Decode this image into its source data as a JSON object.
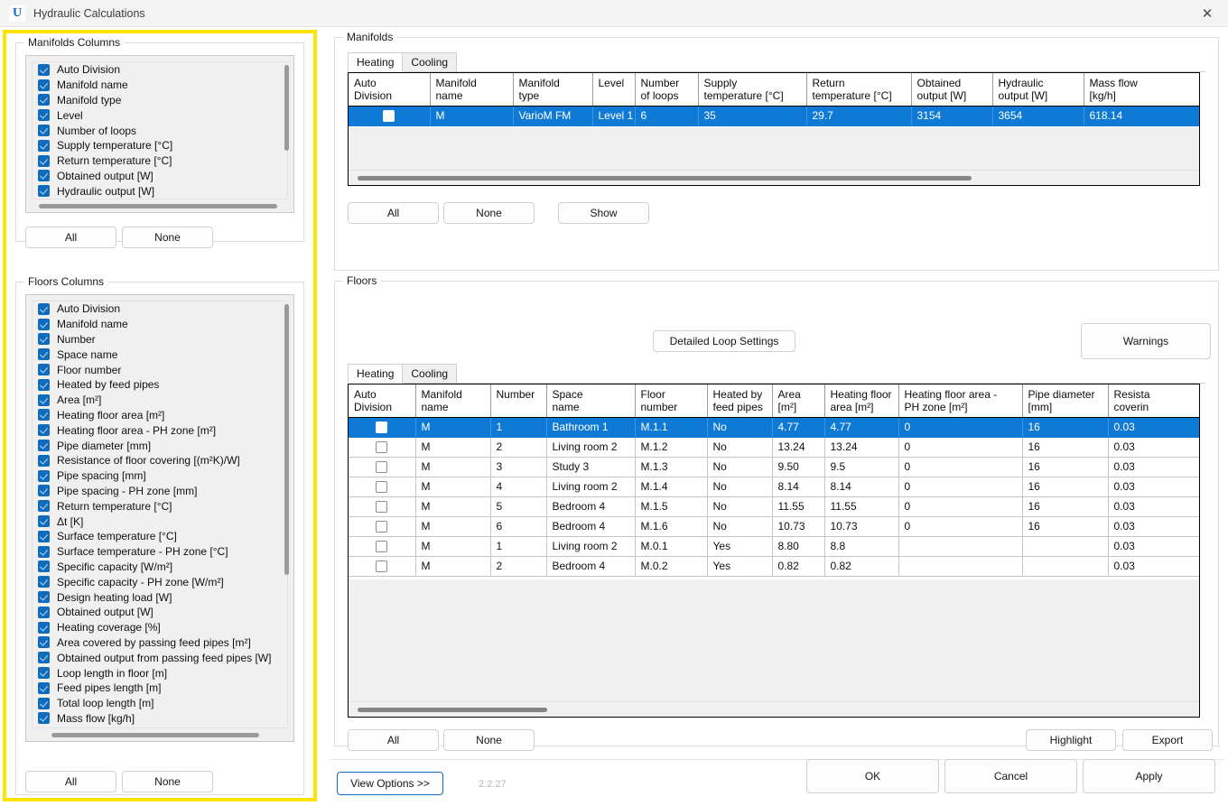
{
  "window": {
    "title": "Hydraulic Calculations",
    "logo_text": "U",
    "close_icon": "close-icon",
    "close_glyph": "✕",
    "highlight_color": "#ffe400",
    "accent_color": "#0f6cbd",
    "selection_color": "#0f7ad6"
  },
  "manifolds_columns": {
    "group_title": "Manifolds Columns",
    "items": [
      "Auto Division",
      "Manifold name",
      "Manifold type",
      "Level",
      "Number of loops",
      "Supply temperature [°C]",
      "Return temperature [°C]",
      "Obtained output [W]",
      "Hydraulic output [W]",
      "Mass flow [kg/h]"
    ],
    "all_label": "All",
    "none_label": "None"
  },
  "floors_columns": {
    "group_title": "Floors Columns",
    "items": [
      "Auto Division",
      "Manifold name",
      "Number",
      "Space name",
      "Floor number",
      "Heated by feed pipes",
      "Area [m²]",
      "Heating floor area [m²]",
      "Heating floor area - PH zone [m²]",
      "Pipe diameter [mm]",
      "Resistance of floor covering [(m²K)/W]",
      "Pipe spacing [mm]",
      "Pipe spacing - PH zone [mm]",
      "Return temperature [°C]",
      "Δt [K]",
      "Surface temperature [°C]",
      "Surface temperature - PH zone [°C]",
      "Specific capacity [W/m²]",
      "Specific capacity - PH zone [W/m²]",
      "Design heating load [W]",
      "Obtained output [W]",
      "Heating coverage [%]",
      "Area covered by passing feed pipes [m²]",
      "Obtained output from passing feed pipes [W]",
      "Loop length in floor  [m]",
      "Feed pipes length  [m]",
      "Total loop length [m]",
      "Mass flow [kg/h]"
    ],
    "all_label": "All",
    "none_label": "None"
  },
  "manifolds_section": {
    "group_title": "Manifolds",
    "tabs": [
      {
        "label": "Heating",
        "active": true
      },
      {
        "label": "Cooling",
        "active": false
      }
    ],
    "headers": [
      "Auto\nDivision",
      "Manifold\nname",
      "Manifold\ntype",
      "Level",
      "Number\nof loops",
      "Supply\ntemperature [°C]",
      "Return\ntemperature [°C]",
      "Obtained\noutput [W]",
      "Hydraulic\noutput [W]",
      "Mass flow\n[kg/h]"
    ],
    "rows": [
      {
        "selected": true,
        "checked": false,
        "cells": [
          "M",
          "VarioM FM",
          "Level 1",
          "6",
          "35",
          "29.7",
          "3154",
          "3654",
          "618.14"
        ]
      }
    ],
    "buttons": {
      "all_label": "All",
      "none_label": "None",
      "show_label": "Show"
    }
  },
  "floors_section": {
    "group_title": "Floors",
    "detailed_loop_settings_label": "Detailed Loop Settings",
    "warnings_label": "Warnings",
    "tabs": [
      {
        "label": "Heating",
        "active": true
      },
      {
        "label": "Cooling",
        "active": false
      }
    ],
    "headers": [
      "Auto\nDivision",
      "Manifold\nname",
      "Number",
      "Space\nname",
      "Floor\nnumber",
      "Heated by\nfeed pipes",
      "Area\n[m²]",
      "Heating floor\narea [m²]",
      "Heating floor area -\nPH zone [m²]",
      "Pipe diameter\n[mm]",
      "Resista\ncoverin"
    ],
    "rows": [
      {
        "selected": true,
        "checked": false,
        "cells": [
          "M",
          "1",
          "Bathroom 1",
          "M.1.1",
          "No",
          "4.77",
          "4.77",
          "0",
          "16",
          "0.03"
        ]
      },
      {
        "selected": false,
        "checked": false,
        "cells": [
          "M",
          "2",
          "Living room 2",
          "M.1.2",
          "No",
          "13.24",
          "13.24",
          "0",
          "16",
          "0.03"
        ]
      },
      {
        "selected": false,
        "checked": false,
        "cells": [
          "M",
          "3",
          "Study 3",
          "M.1.3",
          "No",
          "9.50",
          "9.5",
          "0",
          "16",
          "0.03"
        ]
      },
      {
        "selected": false,
        "checked": false,
        "cells": [
          "M",
          "4",
          "Living room 2",
          "M.1.4",
          "No",
          "8.14",
          "8.14",
          "0",
          "16",
          "0.03"
        ]
      },
      {
        "selected": false,
        "checked": false,
        "cells": [
          "M",
          "5",
          "Bedroom 4",
          "M.1.5",
          "No",
          "11.55",
          "11.55",
          "0",
          "16",
          "0.03"
        ]
      },
      {
        "selected": false,
        "checked": false,
        "cells": [
          "M",
          "6",
          "Bedroom 4",
          "M.1.6",
          "No",
          "10.73",
          "10.73",
          "0",
          "16",
          "0.03"
        ]
      },
      {
        "selected": false,
        "checked": false,
        "cells": [
          "M",
          "1",
          "Living room 2",
          "M.0.1",
          "Yes",
          "8.80",
          "8.8",
          "",
          "",
          "0.03"
        ]
      },
      {
        "selected": false,
        "checked": false,
        "cells": [
          "M",
          "2",
          "Bedroom 4",
          "M.0.2",
          "Yes",
          "0.82",
          "0.82",
          "",
          "",
          "0.03"
        ]
      }
    ],
    "buttons": {
      "all_label": "All",
      "none_label": "None",
      "highlight_label": "Highlight",
      "export_label": "Export"
    }
  },
  "footer": {
    "view_options_label": "View Options >>",
    "version": "2.2.27",
    "ok_label": "OK",
    "cancel_label": "Cancel",
    "apply_label": "Apply"
  }
}
